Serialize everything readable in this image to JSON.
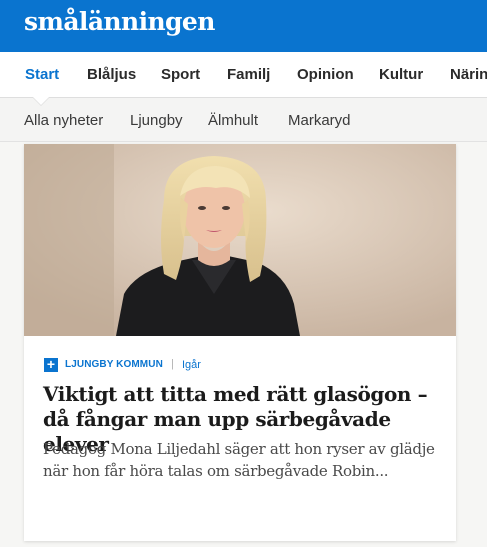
{
  "brand": {
    "logo_text": "smålänningen",
    "color": "#0a74cf"
  },
  "main_nav": {
    "items": [
      {
        "label": "Start",
        "active": true
      },
      {
        "label": "Blåljus"
      },
      {
        "label": "Sport"
      },
      {
        "label": "Familj"
      },
      {
        "label": "Opinion"
      },
      {
        "label": "Kultur"
      },
      {
        "label": "Närin"
      }
    ]
  },
  "sub_nav": {
    "items": [
      {
        "label": "Alla nyheter"
      },
      {
        "label": "Ljungby"
      },
      {
        "label": "Älmhult"
      },
      {
        "label": "Markaryd"
      }
    ]
  },
  "article": {
    "image_icon": "portrait-photo",
    "premium_icon": "plus-icon",
    "section": "LJUNGBY KOMMUN",
    "separator": "|",
    "time": "Igår",
    "headline": "Viktigt att titta med rätt glasögon – då fångar man upp särbegåvade elever",
    "lede": "Pedagog Mona Liljedahl säger att hon ryser av glädje när hon får höra talas om särbegåvade Robin..."
  }
}
